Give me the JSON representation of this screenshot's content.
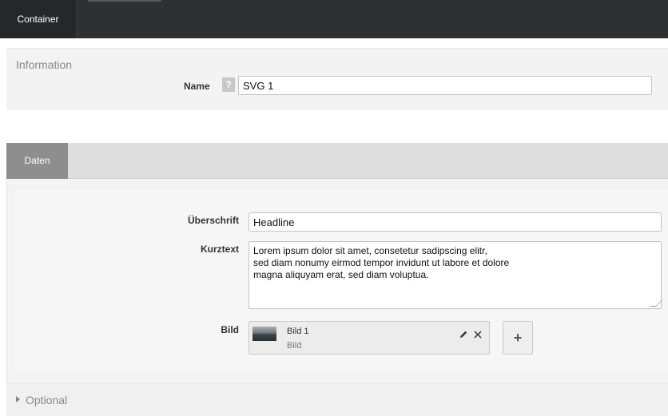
{
  "topbar": {
    "active_tab": "Container"
  },
  "information": {
    "legend": "Information",
    "name_label": "Name",
    "help_icon": "?",
    "name_value": "SVG 1"
  },
  "tabs": [
    {
      "label": "Daten"
    }
  ],
  "fields": {
    "ueberschrift_label": "Überschrift",
    "ueberschrift_value": "Headline",
    "kurztext_label": "Kurztext",
    "kurztext_lines": [
      "Lorem ipsum dolor sit amet, consetetur sadipscing elitr,",
      "sed diam nonumy eirmod tempor invidunt ut labore et dolore",
      "magna aliquyam erat, sed diam voluptua."
    ],
    "bild_label": "Bild",
    "bild_item": {
      "title": "Bild 1",
      "subtitle": "Bild"
    },
    "add_label": "+"
  },
  "optional": {
    "label": "Optional"
  },
  "icons": {
    "edit": "pencil-icon",
    "remove": "close-icon",
    "expand": "caret-right-icon"
  }
}
